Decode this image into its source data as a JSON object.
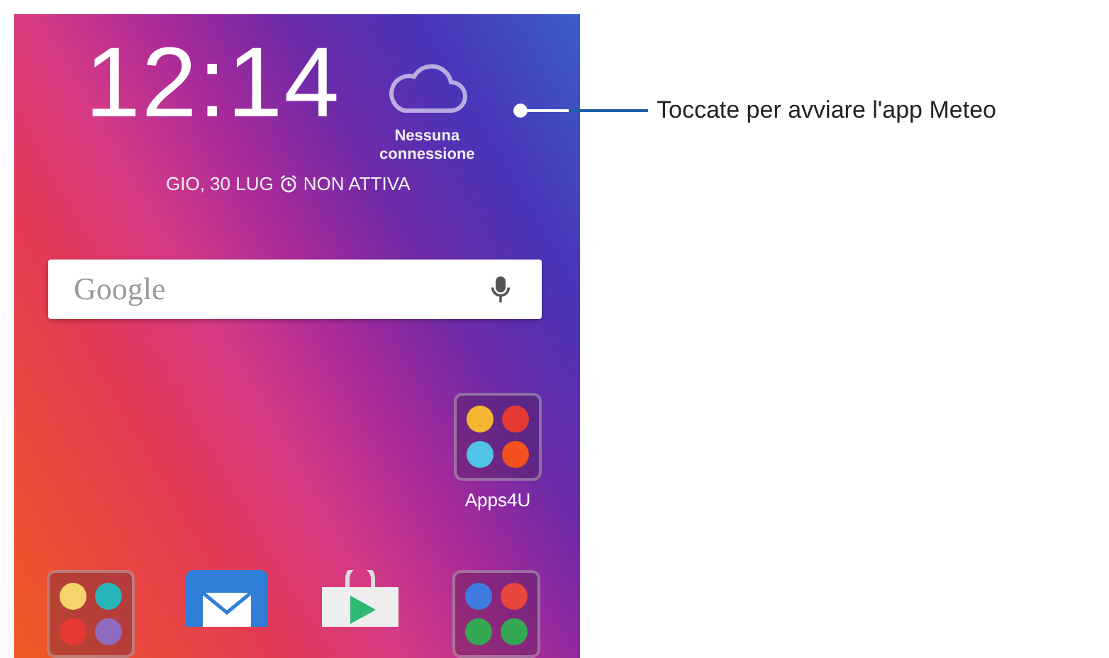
{
  "home_screen": {
    "clock": "12:14",
    "weather": {
      "status": "Nessuna connessione"
    },
    "date": "GIO, 30 LUG",
    "alarm": "NON ATTIVA",
    "search": {
      "logo_text": "Google"
    },
    "folders": [
      {
        "label": "Apps4U",
        "apps": [
          {
            "color": "#f2b632"
          },
          {
            "color": "#e53935"
          },
          {
            "color": "#4fc3e8"
          },
          {
            "color": "#f4511e"
          }
        ]
      }
    ],
    "dock": [
      {
        "kind": "folder",
        "apps": [
          {
            "color": "#f7d36b"
          },
          {
            "color": "#26b5b8"
          },
          {
            "color": "#e53935"
          },
          {
            "color": "#8e6bbf"
          }
        ]
      },
      {
        "kind": "mail"
      },
      {
        "kind": "store"
      },
      {
        "kind": "folder",
        "apps": [
          {
            "color": "#3f7be0"
          },
          {
            "color": "#e8453c"
          },
          {
            "color": "#34a853"
          },
          {
            "color": "#34a853"
          }
        ]
      }
    ]
  },
  "callout": {
    "text": "Toccate per avviare l'app Meteo"
  }
}
